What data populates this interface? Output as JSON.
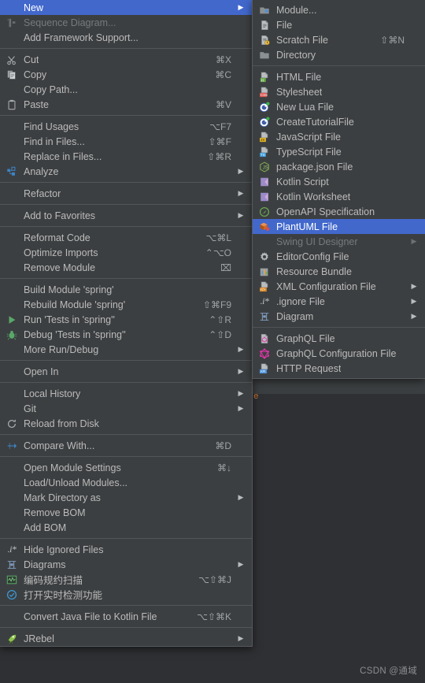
{
  "theme": {
    "menu_bg": "#3c3f41",
    "menu_border": "#565a5c",
    "text": "#bbbbbb",
    "text_disabled": "#777a7c",
    "accent_selected": "#4268cc",
    "separator": "#525658",
    "app_bg": "#2f3033"
  },
  "main_menu": {
    "groups": [
      {
        "items": [
          {
            "label": "New",
            "accel": "",
            "icon": "none",
            "arrow": true,
            "selected": true,
            "disabled": false
          },
          {
            "label": "Sequence Diagram...",
            "accel": "",
            "icon": "sequence-diagram-icon",
            "arrow": false,
            "selected": false,
            "disabled": true
          },
          {
            "label": "Add Framework Support...",
            "accel": "",
            "icon": "none",
            "arrow": false,
            "selected": false,
            "disabled": false
          }
        ]
      },
      {
        "items": [
          {
            "label": "Cut",
            "accel": "⌘X",
            "icon": "scissors-icon",
            "arrow": false,
            "selected": false,
            "disabled": false
          },
          {
            "label": "Copy",
            "accel": "⌘C",
            "icon": "copy-icon",
            "arrow": false,
            "selected": false,
            "disabled": false
          },
          {
            "label": "Copy Path...",
            "accel": "",
            "icon": "none",
            "arrow": false,
            "selected": false,
            "disabled": false
          },
          {
            "label": "Paste",
            "accel": "⌘V",
            "icon": "clipboard-icon",
            "arrow": false,
            "selected": false,
            "disabled": false
          }
        ]
      },
      {
        "items": [
          {
            "label": "Find Usages",
            "accel": "⌥F7",
            "icon": "none",
            "arrow": false,
            "selected": false,
            "disabled": false
          },
          {
            "label": "Find in Files...",
            "accel": "⇧⌘F",
            "icon": "none",
            "arrow": false,
            "selected": false,
            "disabled": false
          },
          {
            "label": "Replace in Files...",
            "accel": "⇧⌘R",
            "icon": "none",
            "arrow": false,
            "selected": false,
            "disabled": false
          },
          {
            "label": "Analyze",
            "accel": "",
            "icon": "analyze-icon",
            "arrow": true,
            "selected": false,
            "disabled": false
          }
        ]
      },
      {
        "items": [
          {
            "label": "Refactor",
            "accel": "",
            "icon": "none",
            "arrow": true,
            "selected": false,
            "disabled": false
          }
        ]
      },
      {
        "items": [
          {
            "label": "Add to Favorites",
            "accel": "",
            "icon": "none",
            "arrow": true,
            "selected": false,
            "disabled": false
          }
        ]
      },
      {
        "items": [
          {
            "label": "Reformat Code",
            "accel": "⌥⌘L",
            "icon": "none",
            "arrow": false,
            "selected": false,
            "disabled": false
          },
          {
            "label": "Optimize Imports",
            "accel": "⌃⌥O",
            "icon": "none",
            "arrow": false,
            "selected": false,
            "disabled": false
          },
          {
            "label": "Remove Module",
            "accel": "⌧",
            "icon": "none",
            "arrow": false,
            "selected": false,
            "disabled": false
          }
        ]
      },
      {
        "items": [
          {
            "label": "Build Module 'spring'",
            "accel": "",
            "icon": "none",
            "arrow": false,
            "selected": false,
            "disabled": false
          },
          {
            "label": "Rebuild Module 'spring'",
            "accel": "⇧⌘F9",
            "icon": "none",
            "arrow": false,
            "selected": false,
            "disabled": false
          },
          {
            "label": "Run 'Tests in 'spring''",
            "accel": "⌃⇧R",
            "icon": "run-icon",
            "arrow": false,
            "selected": false,
            "disabled": false
          },
          {
            "label": "Debug 'Tests in 'spring''",
            "accel": "⌃⇧D",
            "icon": "debug-icon",
            "arrow": false,
            "selected": false,
            "disabled": false
          },
          {
            "label": "More Run/Debug",
            "accel": "",
            "icon": "none",
            "arrow": true,
            "selected": false,
            "disabled": false
          }
        ]
      },
      {
        "items": [
          {
            "label": "Open In",
            "accel": "",
            "icon": "none",
            "arrow": true,
            "selected": false,
            "disabled": false
          }
        ]
      },
      {
        "items": [
          {
            "label": "Local History",
            "accel": "",
            "icon": "none",
            "arrow": true,
            "selected": false,
            "disabled": false
          },
          {
            "label": "Git",
            "accel": "",
            "icon": "none",
            "arrow": true,
            "selected": false,
            "disabled": false
          },
          {
            "label": "Reload from Disk",
            "accel": "",
            "icon": "reload-icon",
            "arrow": false,
            "selected": false,
            "disabled": false
          }
        ]
      },
      {
        "items": [
          {
            "label": "Compare With...",
            "accel": "⌘D",
            "icon": "compare-icon",
            "arrow": false,
            "selected": false,
            "disabled": false
          }
        ]
      },
      {
        "items": [
          {
            "label": "Open Module Settings",
            "accel": "⌘↓",
            "icon": "none",
            "arrow": false,
            "selected": false,
            "disabled": false
          },
          {
            "label": "Load/Unload Modules...",
            "accel": "",
            "icon": "none",
            "arrow": false,
            "selected": false,
            "disabled": false
          },
          {
            "label": "Mark Directory as",
            "accel": "",
            "icon": "none",
            "arrow": true,
            "selected": false,
            "disabled": false
          },
          {
            "label": "Remove BOM",
            "accel": "",
            "icon": "none",
            "arrow": false,
            "selected": false,
            "disabled": false
          },
          {
            "label": "Add BOM",
            "accel": "",
            "icon": "none",
            "arrow": false,
            "selected": false,
            "disabled": false
          }
        ]
      },
      {
        "items": [
          {
            "label": "Hide Ignored Files",
            "accel": "",
            "icon": "ignore-icon",
            "arrow": false,
            "selected": false,
            "disabled": false
          },
          {
            "label": "Diagrams",
            "accel": "",
            "icon": "diagram-icon",
            "arrow": true,
            "selected": false,
            "disabled": false
          },
          {
            "label": "编码规约扫描",
            "accel": "⌥⇧⌘J",
            "icon": "scan-icon",
            "arrow": false,
            "selected": false,
            "disabled": false
          },
          {
            "label": "打开实时检测功能",
            "accel": "",
            "icon": "check-circle-icon",
            "arrow": false,
            "selected": false,
            "disabled": false
          }
        ]
      },
      {
        "items": [
          {
            "label": "Convert Java File to Kotlin File",
            "accel": "⌥⇧⌘K",
            "icon": "none",
            "arrow": false,
            "selected": false,
            "disabled": false
          }
        ]
      },
      {
        "items": [
          {
            "label": "JRebel",
            "accel": "",
            "icon": "jrebel-icon",
            "arrow": true,
            "selected": false,
            "disabled": false
          }
        ]
      }
    ]
  },
  "new_submenu": {
    "groups": [
      {
        "items": [
          {
            "label": "Module...",
            "accel": "",
            "icon": "module-icon",
            "arrow": false,
            "selected": false,
            "disabled": false
          },
          {
            "label": "File",
            "accel": "",
            "icon": "file-icon",
            "arrow": false,
            "selected": false,
            "disabled": false
          },
          {
            "label": "Scratch File",
            "accel": "⇧⌘N",
            "icon": "scratch-file-icon",
            "arrow": false,
            "selected": false,
            "disabled": false
          },
          {
            "label": "Directory",
            "accel": "",
            "icon": "folder-icon",
            "arrow": false,
            "selected": false,
            "disabled": false
          }
        ]
      },
      {
        "items": [
          {
            "label": "HTML File",
            "accel": "",
            "icon": "html-file-icon",
            "arrow": false,
            "selected": false,
            "disabled": false
          },
          {
            "label": "Stylesheet",
            "accel": "",
            "icon": "css-file-icon",
            "arrow": false,
            "selected": false,
            "disabled": false
          },
          {
            "label": "New Lua File",
            "accel": "",
            "icon": "lua-file-icon",
            "arrow": false,
            "selected": false,
            "disabled": false
          },
          {
            "label": "CreateTutorialFile",
            "accel": "",
            "icon": "lua-file-icon",
            "arrow": false,
            "selected": false,
            "disabled": false
          },
          {
            "label": "JavaScript File",
            "accel": "",
            "icon": "js-file-icon",
            "arrow": false,
            "selected": false,
            "disabled": false
          },
          {
            "label": "TypeScript File",
            "accel": "",
            "icon": "ts-file-icon",
            "arrow": false,
            "selected": false,
            "disabled": false
          },
          {
            "label": "package.json File",
            "accel": "",
            "icon": "nodejs-icon",
            "arrow": false,
            "selected": false,
            "disabled": false
          },
          {
            "label": "Kotlin Script",
            "accel": "",
            "icon": "kotlin-icon",
            "arrow": false,
            "selected": false,
            "disabled": false
          },
          {
            "label": "Kotlin Worksheet",
            "accel": "",
            "icon": "kotlin-icon",
            "arrow": false,
            "selected": false,
            "disabled": false
          },
          {
            "label": "OpenAPI Specification",
            "accel": "",
            "icon": "openapi-icon",
            "arrow": false,
            "selected": false,
            "disabled": false
          },
          {
            "label": "PlantUML File",
            "accel": "",
            "icon": "plantuml-icon",
            "arrow": false,
            "selected": true,
            "disabled": false
          },
          {
            "label": "Swing UI Designer",
            "accel": "",
            "icon": "none",
            "arrow": true,
            "selected": false,
            "disabled": true
          },
          {
            "label": "EditorConfig File",
            "accel": "",
            "icon": "gear-icon",
            "arrow": false,
            "selected": false,
            "disabled": false
          },
          {
            "label": "Resource Bundle",
            "accel": "",
            "icon": "resource-bundle-icon",
            "arrow": false,
            "selected": false,
            "disabled": false
          },
          {
            "label": "XML Configuration File",
            "accel": "",
            "icon": "xml-file-icon",
            "arrow": true,
            "selected": false,
            "disabled": false
          },
          {
            "label": ".ignore File",
            "accel": "",
            "icon": "ignore-icon",
            "arrow": true,
            "selected": false,
            "disabled": false
          },
          {
            "label": "Diagram",
            "accel": "",
            "icon": "diagram-icon",
            "arrow": true,
            "selected": false,
            "disabled": false
          }
        ]
      },
      {
        "items": [
          {
            "label": "GraphQL File",
            "accel": "",
            "icon": "graphql-file-icon",
            "arrow": false,
            "selected": false,
            "disabled": false
          },
          {
            "label": "GraphQL Configuration File",
            "accel": "",
            "icon": "graphql-icon",
            "arrow": false,
            "selected": false,
            "disabled": false
          },
          {
            "label": "HTTP Request",
            "accel": "",
            "icon": "http-request-icon",
            "arrow": false,
            "selected": false,
            "disabled": false
          }
        ]
      }
    ]
  },
  "watermark": {
    "text": "CSDN @通域"
  }
}
